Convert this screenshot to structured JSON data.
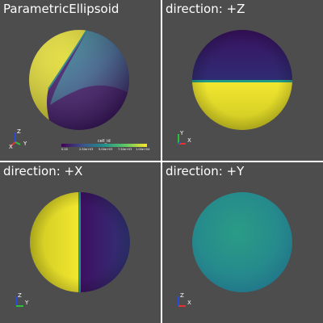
{
  "viewports": [
    {
      "id": "tl",
      "title": "ParametricEllipsoid",
      "axes_labels": [
        "Z",
        "X",
        "Y"
      ]
    },
    {
      "id": "tr",
      "title": "direction: +Z",
      "axes_labels": [
        "Y",
        "X"
      ]
    },
    {
      "id": "bl",
      "title": "direction: +X",
      "axes_labels": [
        "Z",
        "Y"
      ]
    },
    {
      "id": "br",
      "title": "direction: +Y",
      "axes_labels": [
        "Z",
        "X"
      ]
    }
  ],
  "scalar_bar": {
    "title": "cell_id",
    "ticks": [
      "0.00",
      "2.50e+03",
      "5.00e+03",
      "7.50e+03",
      "1.00e+04"
    ]
  },
  "colors": {
    "background": "#4d4d4d",
    "border": "#ffffff",
    "viridis_dark": "#3e0a58",
    "viridis_mid": "#26838e",
    "viridis_yellow": "#e9e520"
  }
}
